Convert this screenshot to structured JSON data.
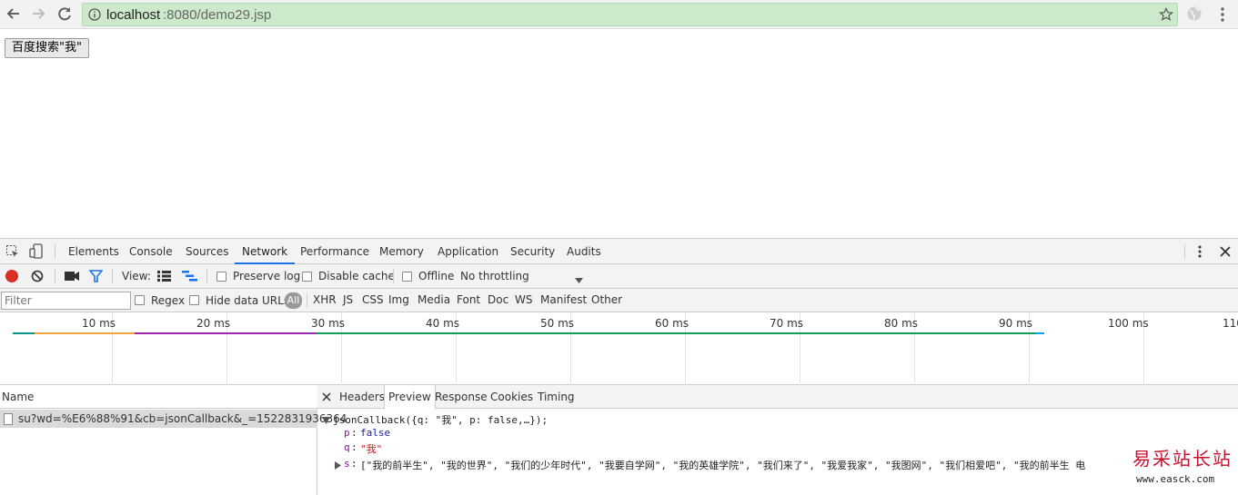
{
  "browser": {
    "back_icon": "arrow-left-icon",
    "forward_icon": "arrow-right-icon",
    "reload_icon": "reload-icon",
    "url_host": "localhost",
    "url_path": ":8080/demo29.jsp",
    "star_icon": "star-icon",
    "menu_icon": "kebab-menu-icon",
    "omnibox_color": "#cde9cb"
  },
  "page": {
    "button_label": "百度搜索\"我\""
  },
  "devtools": {
    "tabs": [
      "Elements",
      "Console",
      "Sources",
      "Network",
      "Performance",
      "Memory",
      "Application",
      "Security",
      "Audits"
    ],
    "active_tab": "Network",
    "toolbar": {
      "view_label": "View:",
      "preserve_log": "Preserve log",
      "disable_cache": "Disable cache",
      "offline": "Offline",
      "throttling": "No throttling",
      "record_color": "#d93025"
    },
    "filter": {
      "placeholder": "Filter",
      "regex": "Regex",
      "hide_data_urls": "Hide data URLs",
      "all": "All",
      "types": [
        "XHR",
        "JS",
        "CSS",
        "Img",
        "Media",
        "Font",
        "Doc",
        "WS",
        "Manifest",
        "Other"
      ]
    },
    "timeline": {
      "ticks": [
        "10 ms",
        "20 ms",
        "30 ms",
        "40 ms",
        "50 ms",
        "60 ms",
        "70 ms",
        "80 ms",
        "90 ms",
        "100 ms",
        "110"
      ],
      "colors": [
        "#009688",
        "#f2a53a",
        "#9c27b0",
        "#0f9d58",
        "#00a6e8"
      ]
    },
    "requests": {
      "name_header": "Name",
      "rows": [
        "su?wd=%E6%88%91&cb=jsonCallback&_=1522831936364"
      ]
    },
    "details": {
      "tabs": [
        "Headers",
        "Preview",
        "Response",
        "Cookies",
        "Timing"
      ],
      "active": "Preview",
      "preview": {
        "root": "jsonCallback({q: \"我\", p: false,…});",
        "p_key": "p",
        "p_val": "false",
        "q_key": "q",
        "q_val": "\"我\"",
        "s_key": "s",
        "s_val": "[\"我的前半生\", \"我的世界\", \"我们的少年时代\", \"我要自学网\", \"我的英雄学院\", \"我们来了\", \"我爱我家\", \"我图网\", \"我们相爱吧\", \"我的前半生 电"
      }
    }
  },
  "watermark": {
    "title": "易采站长站",
    "url": "www.easck.com"
  }
}
